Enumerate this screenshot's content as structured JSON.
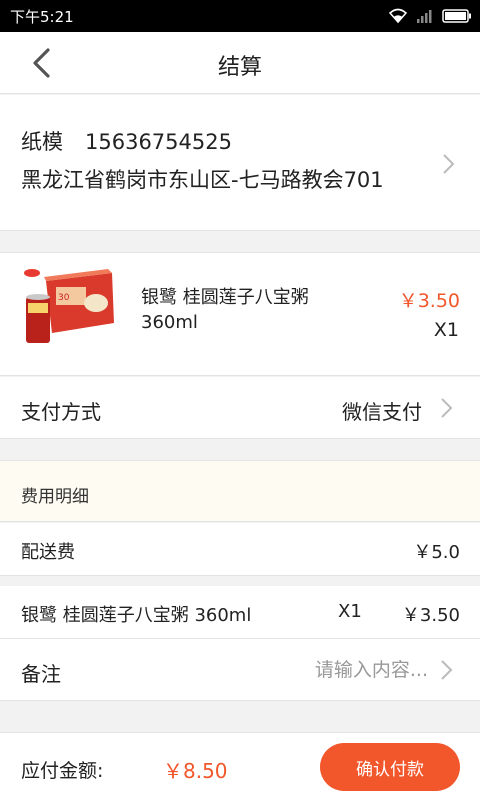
{
  "status_bar": {
    "time": "下午5:21"
  },
  "header": {
    "title": "结算"
  },
  "address": {
    "name": "纸模",
    "phone": "15636754525",
    "detail": "黑龙江省鹤岗市东山区-七马路教会701"
  },
  "product": {
    "name": "银鹭 桂圆莲子八宝粥360ml",
    "price": "￥3.50",
    "quantity": "X1",
    "image_icon": "product-box-image"
  },
  "payment": {
    "label": "支付方式",
    "value": "微信支付"
  },
  "fees": {
    "header": "费用明细",
    "delivery": {
      "label": "配送费",
      "amount": "￥5.0"
    },
    "item": {
      "label": "银鹭 桂圆莲子八宝粥 360ml",
      "quantity": "X1",
      "amount": "￥3.50"
    }
  },
  "note": {
    "label": "备注",
    "placeholder": "请输入内容...",
    "value": ""
  },
  "footer": {
    "label": "应付金额:",
    "total": "￥8.50",
    "button_label": "确认付款"
  },
  "colors": {
    "accent": "#f2572c",
    "fee_header_bg": "#fdfbf2",
    "page_bg": "#f2f2f2"
  }
}
